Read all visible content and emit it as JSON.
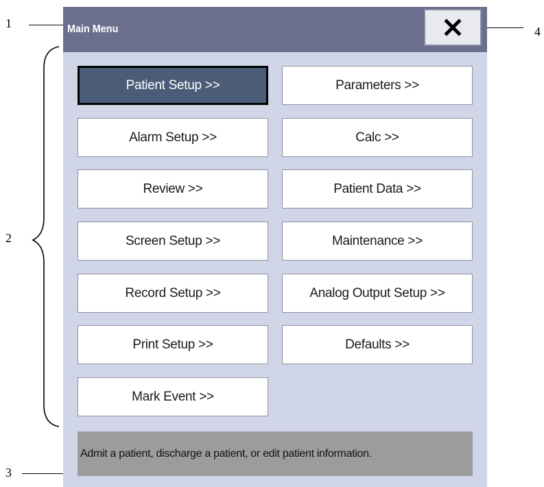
{
  "callouts": {
    "one": "1",
    "two": "2",
    "three": "3",
    "four": "4"
  },
  "window": {
    "title": "Main Menu",
    "close_icon": "close-icon",
    "title_bar_color": "#6c6e8e",
    "panel_color": "#d0d6e8"
  },
  "menu": {
    "items": [
      {
        "label": "Patient Setup >>",
        "selected": true
      },
      {
        "label": "Parameters >>"
      },
      {
        "label": "Alarm Setup >>"
      },
      {
        "label": "Calc >>"
      },
      {
        "label": "Review >>"
      },
      {
        "label": "Patient Data >>"
      },
      {
        "label": "Screen Setup >>"
      },
      {
        "label": "Maintenance >>"
      },
      {
        "label": "Record Setup >>"
      },
      {
        "label": "Analog Output Setup >>"
      },
      {
        "label": "Print Setup >>"
      },
      {
        "label": "Defaults >>"
      },
      {
        "label": "Mark Event >>"
      }
    ],
    "selected_color": "#4b5c78"
  },
  "help": {
    "text": "Admit a patient, discharge a patient, or edit patient information."
  }
}
